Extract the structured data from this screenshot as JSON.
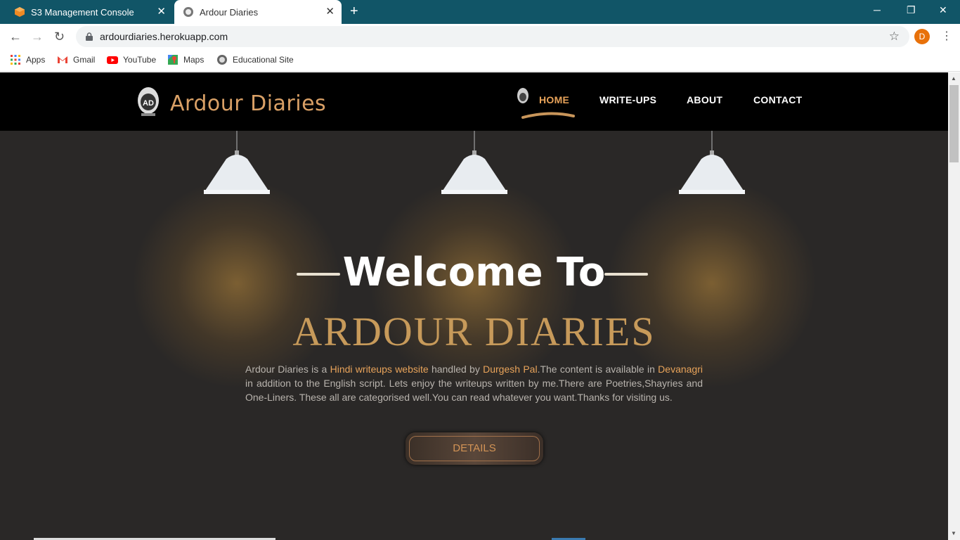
{
  "browser": {
    "tabs": [
      {
        "title": "S3 Management Console",
        "close": "✕"
      },
      {
        "title": "Ardour Diaries",
        "close": "✕"
      }
    ],
    "new_tab": "+",
    "window_controls": {
      "minimize": "─",
      "restore": "❐",
      "close": "✕"
    },
    "nav": {
      "back": "←",
      "forward": "→",
      "reload": "↻"
    },
    "url": "ardourdiaries.herokuapp.com",
    "star": "☆",
    "profile_initial": "D",
    "menu": "⋮",
    "bookmarks": [
      "Apps",
      "Gmail",
      "YouTube",
      "Maps",
      "Educational Site"
    ]
  },
  "site": {
    "brand": "Ardour Diaries",
    "logo_text": "AD",
    "nav": [
      {
        "label": "HOME",
        "active": true
      },
      {
        "label": "WRITE-UPS",
        "active": false
      },
      {
        "label": "ABOUT",
        "active": false
      },
      {
        "label": "CONTACT",
        "active": false
      }
    ],
    "hero": {
      "welcome": "Welcome To",
      "title": "ARDOUR DIARIES",
      "intro_parts": [
        {
          "text": "Ardour Diaries is a ",
          "hl": false
        },
        {
          "text": "Hindi writeups website",
          "hl": true
        },
        {
          "text": " handled by ",
          "hl": false
        },
        {
          "text": "Durgesh Pal",
          "hl": true
        },
        {
          "text": ".The content is available in ",
          "hl": false
        },
        {
          "text": "Devanagri",
          "hl": true
        },
        {
          "text": " in addition to the English script. Lets enjoy the writeups written by me.There are Poetries,Shayries and One-Liners. These all are categorised well.You can read whatever you want.Thanks for visiting us.",
          "hl": false
        }
      ],
      "button": "DETAILS"
    }
  },
  "colors": {
    "tabbar": "#115567",
    "page_bg": "#2a2827",
    "accent": "#e8a35a",
    "title_gold": "#c79a5a"
  }
}
